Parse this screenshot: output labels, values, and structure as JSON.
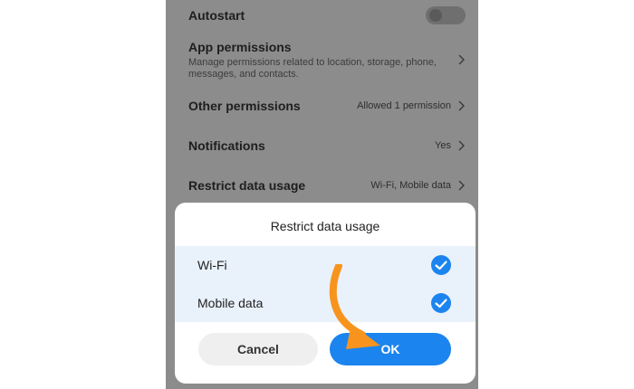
{
  "settings": {
    "autostart": {
      "title": "Autostart",
      "enabled": false
    },
    "app_permissions": {
      "title": "App permissions",
      "subtitle": "Manage permissions related to location, storage, phone, messages, and contacts."
    },
    "other_permissions": {
      "title": "Other permissions",
      "value": "Allowed 1 permission"
    },
    "notifications": {
      "title": "Notifications",
      "value": "Yes"
    },
    "restrict_data": {
      "title": "Restrict data usage",
      "value": "Wi-Fi, Mobile data"
    }
  },
  "dialog": {
    "title": "Restrict data usage",
    "options": [
      {
        "label": "Wi-Fi",
        "checked": true
      },
      {
        "label": "Mobile data",
        "checked": true
      }
    ],
    "cancel_label": "Cancel",
    "ok_label": "OK"
  },
  "colors": {
    "accent": "#1b84ee",
    "arrow": "#f7941d",
    "overlay": "#8c8c8c"
  },
  "icons": {
    "chevron": "chevron-right-icon",
    "check": "checkmark-circle-icon",
    "pointer": "curved-arrow-icon"
  }
}
